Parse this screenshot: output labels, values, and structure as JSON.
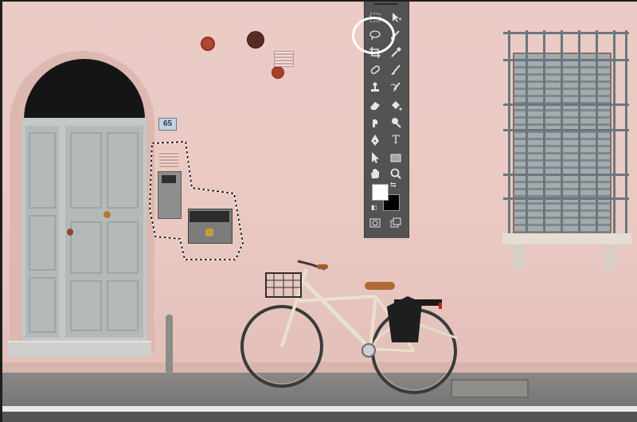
{
  "house_number": "65",
  "toolbar": {
    "tools": [
      {
        "name": "marquee",
        "icon": "rectangular-marquee-icon",
        "glyph": "⬚"
      },
      {
        "name": "move",
        "icon": "move-icon",
        "glyph": "✥"
      },
      {
        "name": "lasso",
        "icon": "lasso-icon",
        "glyph": "◯",
        "selected": true
      },
      {
        "name": "quick-selection",
        "icon": "quick-selection-brush-icon",
        "glyph": "✎"
      },
      {
        "name": "crop",
        "icon": "crop-icon",
        "glyph": "⌗"
      },
      {
        "name": "eyedropper",
        "icon": "eyedropper-icon",
        "glyph": "✐"
      },
      {
        "name": "healing",
        "icon": "healing-bandage-icon",
        "glyph": "⊘"
      },
      {
        "name": "brush",
        "icon": "brush-icon",
        "glyph": "✒"
      },
      {
        "name": "clone-stamp",
        "icon": "clone-stamp-icon",
        "glyph": "⊥"
      },
      {
        "name": "history-brush",
        "icon": "history-brush-icon",
        "glyph": "↺"
      },
      {
        "name": "eraser",
        "icon": "eraser-icon",
        "glyph": "▱"
      },
      {
        "name": "paint-bucket",
        "icon": "paint-bucket-icon",
        "glyph": "◈"
      },
      {
        "name": "smudge",
        "icon": "smudge-icon",
        "glyph": "☝"
      },
      {
        "name": "dodge",
        "icon": "dodge-icon",
        "glyph": "●"
      },
      {
        "name": "pen",
        "icon": "pen-icon",
        "glyph": "✑"
      },
      {
        "name": "type",
        "icon": "type-icon",
        "glyph": "T"
      },
      {
        "name": "path-selection",
        "icon": "path-selection-arrow-icon",
        "glyph": "➤"
      },
      {
        "name": "shape",
        "icon": "rectangle-shape-icon",
        "glyph": "▭"
      },
      {
        "name": "hand",
        "icon": "hand-icon",
        "glyph": "✋"
      },
      {
        "name": "zoom",
        "icon": "zoom-icon",
        "glyph": "🔍"
      },
      {
        "name": "quick-mask",
        "icon": "quick-mask-icon",
        "glyph": "◙"
      },
      {
        "name": "screen-mode",
        "icon": "screen-mode-icon",
        "glyph": "❐"
      }
    ],
    "foreground_color": "#ffffff",
    "background_color": "#000000"
  },
  "colors": {
    "wall": "#ebcbc5",
    "toolbar": "#535353",
    "door": "#b3bab9",
    "shutter": "#a3abae"
  }
}
